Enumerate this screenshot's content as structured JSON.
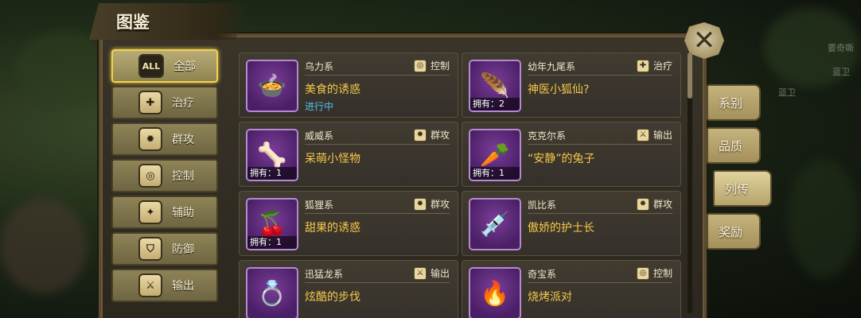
{
  "window": {
    "title": "图鉴"
  },
  "close_button": {
    "icon": "close-icon",
    "glyph": "✕"
  },
  "categories": [
    {
      "label": "全部",
      "icon": "all-icon",
      "glyph": "ALL",
      "active": true
    },
    {
      "label": "治疗",
      "icon": "heal-cross-icon",
      "glyph": "✚",
      "active": false
    },
    {
      "label": "群攻",
      "icon": "aoe-claw-icon",
      "glyph": "✹",
      "active": false
    },
    {
      "label": "控制",
      "icon": "spiral-control-icon",
      "glyph": "◎",
      "active": false
    },
    {
      "label": "辅助",
      "icon": "support-icon",
      "glyph": "✦",
      "active": false
    },
    {
      "label": "防御",
      "icon": "shield-icon",
      "glyph": "⛉",
      "active": false
    },
    {
      "label": "输出",
      "icon": "sword-icon",
      "glyph": "⚔",
      "active": false
    }
  ],
  "cards": [
    {
      "series": "乌力系",
      "tag": "控制",
      "tag_icon": "spiral-control-icon",
      "tag_glyph": "◎",
      "name": "美食的诱惑",
      "status": "进行中",
      "owned": "",
      "thumb_icon": "food-pot-icon",
      "thumb_glyph": "🍲"
    },
    {
      "series": "幼年九尾系",
      "tag": "治疗",
      "tag_icon": "heal-cross-icon",
      "tag_glyph": "✚",
      "name": "神医小狐仙?",
      "status": "",
      "owned": "拥有：2",
      "thumb_icon": "feather-icon",
      "thumb_glyph": "🪶"
    },
    {
      "series": "威威系",
      "tag": "群攻",
      "tag_icon": "aoe-claw-icon",
      "tag_glyph": "✹",
      "name": "呆萌小怪物",
      "status": "",
      "owned": "拥有：1",
      "thumb_icon": "horn-icon",
      "thumb_glyph": "🦴"
    },
    {
      "series": "克克尔系",
      "tag": "输出",
      "tag_icon": "sword-icon",
      "tag_glyph": "⚔",
      "name": "“安静”的兔子",
      "status": "",
      "owned": "拥有：1",
      "thumb_icon": "carrot-icon",
      "thumb_glyph": "🥕"
    },
    {
      "series": "狐狸系",
      "tag": "群攻",
      "tag_icon": "aoe-claw-icon",
      "tag_glyph": "✹",
      "name": "甜果的诱惑",
      "status": "",
      "owned": "拥有：1",
      "thumb_icon": "cherry-icon",
      "thumb_glyph": "🍒"
    },
    {
      "series": "凯比系",
      "tag": "群攻",
      "tag_icon": "aoe-claw-icon",
      "tag_glyph": "✹",
      "name": "傲娇的护士长",
      "status": "",
      "owned": "",
      "thumb_icon": "syringe-icon",
      "thumb_glyph": "💉"
    },
    {
      "series": "迅猛龙系",
      "tag": "输出",
      "tag_icon": "sword-icon",
      "tag_glyph": "⚔",
      "name": "炫酷的步伐",
      "status": "",
      "owned": "",
      "thumb_icon": "ring-icon",
      "thumb_glyph": "💍"
    },
    {
      "series": "奇宝系",
      "tag": "控制",
      "tag_icon": "spiral-control-icon",
      "tag_glyph": "◎",
      "name": "烧烤派对",
      "status": "",
      "owned": "",
      "thumb_icon": "torch-icon",
      "thumb_glyph": "🔥"
    }
  ],
  "right_tabs": [
    {
      "label": "系别",
      "active": false
    },
    {
      "label": "品质",
      "active": false
    },
    {
      "label": "列传",
      "active": true
    },
    {
      "label": "奖励",
      "active": false
    }
  ],
  "background_text": {
    "top_right": "要奇嘶",
    "mid_right_1": "蓝卫",
    "mid_right_2": "蓝卫"
  },
  "colors": {
    "accent_gold": "#f6c94a",
    "status_blue": "#53c0e8",
    "thumb_purple": "#4a1f66"
  }
}
